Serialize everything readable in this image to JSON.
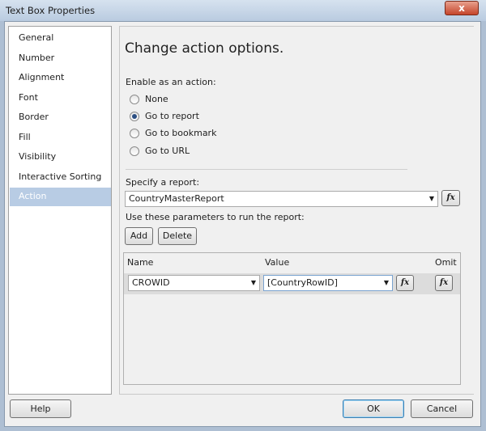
{
  "window": {
    "title": "Text Box Properties",
    "close": "x"
  },
  "sidebar": {
    "items": [
      {
        "label": "General"
      },
      {
        "label": "Number"
      },
      {
        "label": "Alignment"
      },
      {
        "label": "Font"
      },
      {
        "label": "Border"
      },
      {
        "label": "Fill"
      },
      {
        "label": "Visibility"
      },
      {
        "label": "Interactive Sorting"
      },
      {
        "label": "Action"
      }
    ],
    "selected": "Action"
  },
  "main": {
    "heading": "Change action options.",
    "enable_label": "Enable as an action:",
    "options": [
      {
        "label": "None",
        "checked": false
      },
      {
        "label": "Go to report",
        "checked": true
      },
      {
        "label": "Go to bookmark",
        "checked": false
      },
      {
        "label": "Go to URL",
        "checked": false
      }
    ],
    "report_label": "Specify a report:",
    "report_value": "CountryMasterReport",
    "fx": "fx",
    "params_label": "Use these parameters to run the report:",
    "add": "Add",
    "delete": "Delete",
    "grid": {
      "headers": [
        "Name",
        "Value",
        "Omit"
      ],
      "rows": [
        {
          "name": "CROWID",
          "value": "[CountryRowID]"
        }
      ]
    }
  },
  "footer": {
    "help": "Help",
    "ok": "OK",
    "cancel": "Cancel"
  }
}
